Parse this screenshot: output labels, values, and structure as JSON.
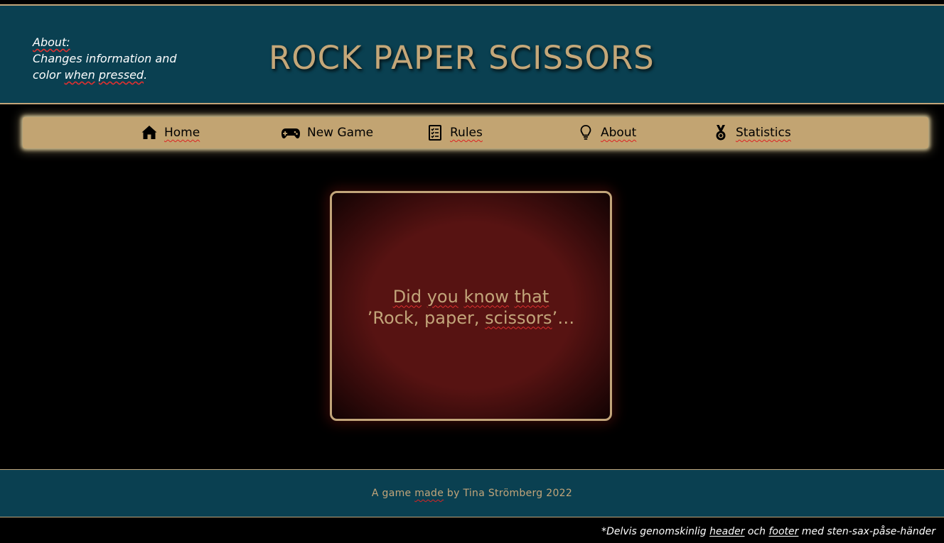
{
  "header": {
    "about_label": "About:",
    "about_line1": "Changes information and",
    "about_line2_a": "color",
    "about_line2_b": "when",
    "about_line2_c": "pressed",
    "title": "ROCK PAPER SCISSORS"
  },
  "nav": {
    "items": [
      {
        "label": "Home",
        "icon": "home-icon"
      },
      {
        "label": "New Game",
        "icon": "gamepad-icon"
      },
      {
        "label": "Rules",
        "icon": "checklist-icon"
      },
      {
        "label": "About",
        "icon": "lightbulb-icon"
      },
      {
        "label": "Statistics",
        "icon": "medal-icon"
      }
    ]
  },
  "fact": {
    "line1_a": "Did",
    "line1_b": "you",
    "line1_c": "know",
    "line1_d": "that",
    "line2_a": "’Rock, paper,",
    "line2_b": "scissors",
    "line2_c": "’…"
  },
  "footer": {
    "text_a": "A game",
    "text_b": "made",
    "text_c": "by Tina Strömberg 2022"
  },
  "bottom_note": {
    "a": "*Delvis genomskinlig",
    "b": "header",
    "c": "och",
    "d": "footer",
    "e": "med sten-sax-påse-händer"
  },
  "colors": {
    "header_bg": "#0a4051",
    "accent_gold": "#c2a57a",
    "nav_bg": "#c2a472",
    "card_red": "#571312",
    "page_bg": "#000000"
  }
}
